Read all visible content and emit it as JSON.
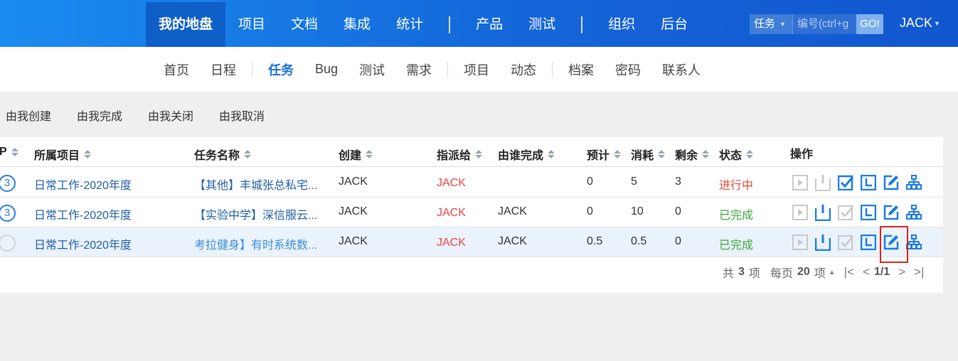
{
  "topnav": {
    "items": [
      "我的地盘",
      "项目",
      "文档",
      "集成",
      "统计",
      "产品",
      "测试",
      "组织",
      "后台"
    ],
    "active": "我的地盘"
  },
  "search": {
    "type": "任务",
    "placeholder": "编号(ctrl+g",
    "go_label": "GO!"
  },
  "user": {
    "name": "JACK"
  },
  "subnav": {
    "items": [
      "首页",
      "日程",
      "任务",
      "Bug",
      "测试",
      "需求",
      "项目",
      "动态",
      "档案",
      "密码",
      "联系人"
    ],
    "active": "任务"
  },
  "filters": [
    "由我创建",
    "由我完成",
    "由我关闭",
    "由我取消"
  ],
  "table": {
    "headers": [
      "P",
      "所属项目",
      "任务名称",
      "创建",
      "指派给",
      "由谁完成",
      "预计",
      "消耗",
      "剩余",
      "状态",
      "操作"
    ],
    "rows": [
      {
        "pri": "3",
        "project": "日常工作-2020年度",
        "name": "【其他】丰城张总私宅...",
        "creator": "JACK",
        "assigned": "JACK",
        "finished_by": "",
        "estimate": "0",
        "consumed": "5",
        "left": "3",
        "status": "进行中",
        "status_color": "#e04a3a"
      },
      {
        "pri": "3",
        "project": "日常工作-2020年度",
        "name": "【实验中学】深信服云...",
        "creator": "JACK",
        "assigned": "JACK",
        "finished_by": "JACK",
        "estimate": "0",
        "consumed": "10",
        "left": "0",
        "status": "已完成",
        "status_color": "#3aa63a"
      },
      {
        "pri": "",
        "project": "日常工作-2020年度",
        "name": "考拉健身】有时系统数...",
        "creator": "JACK",
        "assigned": "JACK",
        "finished_by": "JACK",
        "estimate": "0.5",
        "consumed": "0.5",
        "left": "0",
        "status": "已完成",
        "status_color": "#3aa63a"
      }
    ],
    "action_icons": [
      "start-icon",
      "close-icon",
      "finish-icon",
      "record-effort-icon",
      "edit-icon",
      "batch-create-icon"
    ]
  },
  "pager": {
    "total_prefix": "共",
    "total": "3",
    "total_unit": "项",
    "per_page_prefix": "每页",
    "per_page": "20",
    "per_page_unit": "项",
    "page": "1/1"
  },
  "colors": {
    "topbar": "#1466d8",
    "accent": "#1a6fd8",
    "highlight": "#d9231a"
  }
}
